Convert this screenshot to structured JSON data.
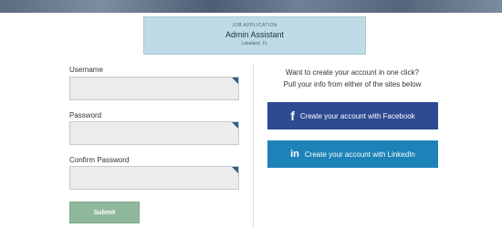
{
  "job": {
    "kicker": "JOB APPLICATION",
    "title": "Admin Assistant",
    "location": "Lakeland, FL"
  },
  "form": {
    "username_label": "Username",
    "username_value": "",
    "password_label": "Password",
    "password_value": "",
    "confirm_label": "Confirm Password",
    "confirm_value": "",
    "submit_label": "Submit"
  },
  "social": {
    "prompt_line1": "Want to create your account in one click?",
    "prompt_line2": "Pull your info from either of the sites below",
    "facebook_label": "Create your account with Facebook",
    "facebook_icon": "facebook-icon",
    "linkedin_label": "Create your account with LinkedIn",
    "linkedin_icon": "linkedin-icon"
  },
  "colors": {
    "job_card_bg": "#bfdbe6",
    "facebook_blue": "#2e4a92",
    "linkedin_blue": "#1d82b8",
    "submit_green": "#8fb79c",
    "input_bg": "#ececec",
    "input_corner": "#2e5f86"
  }
}
